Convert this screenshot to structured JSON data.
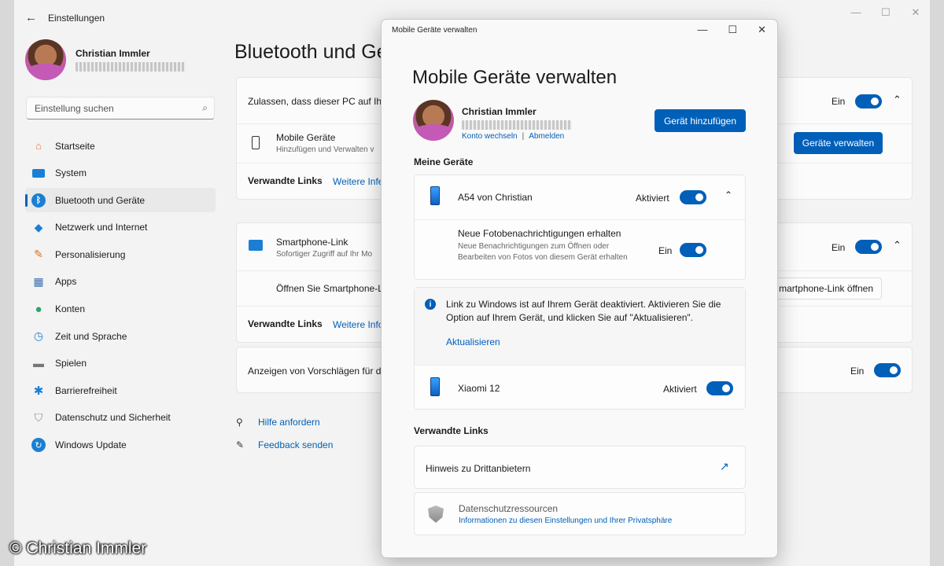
{
  "settings": {
    "title": "Einstellungen",
    "user": {
      "name": "Christian Immler"
    },
    "search": {
      "placeholder": "Einstellung suchen"
    },
    "nav": [
      {
        "label": "Startseite",
        "icon": "home-icon"
      },
      {
        "label": "System",
        "icon": "system-icon"
      },
      {
        "label": "Bluetooth und Geräte",
        "icon": "bluetooth-icon"
      },
      {
        "label": "Netzwerk und Internet",
        "icon": "network-icon"
      },
      {
        "label": "Personalisierung",
        "icon": "brush-icon"
      },
      {
        "label": "Apps",
        "icon": "apps-icon"
      },
      {
        "label": "Konten",
        "icon": "accounts-icon"
      },
      {
        "label": "Zeit und Sprache",
        "icon": "time-language-icon"
      },
      {
        "label": "Spielen",
        "icon": "gaming-icon"
      },
      {
        "label": "Barrierefreiheit",
        "icon": "accessibility-icon"
      },
      {
        "label": "Datenschutz und Sicherheit",
        "icon": "privacy-shield-icon"
      },
      {
        "label": "Windows Update",
        "icon": "update-icon"
      }
    ],
    "page_title": "Bluetooth und Ge",
    "card1": {
      "allow_label": "Zulassen, dass dieser PC auf Ihr",
      "allow_state": "Ein",
      "mobile_title": "Mobile Geräte",
      "mobile_sub": "Hinzufügen und Verwalten v",
      "manage_button": "Geräte verwalten",
      "related_label": "Verwandte Links",
      "related_link": "Weitere Infe"
    },
    "card2": {
      "title": "Smartphone-Link",
      "sub": "Sofortiger Zugriff auf Ihr Mo",
      "state": "Ein",
      "open_label": "Öffnen Sie Smartphone-L",
      "open_button": "martphone-Link öffnen",
      "related_label": "Verwandte Links",
      "related_link": "Weitere Info"
    },
    "card3": {
      "label": "Anzeigen von Vorschlägen für d",
      "state": "Ein"
    },
    "help": "Hilfe anfordern",
    "feedback": "Feedback senden",
    "accent": "#005fb8"
  },
  "dialog": {
    "window_title": "Mobile Geräte verwalten",
    "heading": "Mobile Geräte verwalten",
    "user_name": "Christian Immler",
    "switch_account": "Konto wechseln",
    "separator": "|",
    "sign_out": "Abmelden",
    "add_device": "Gerät hinzufügen",
    "my_devices_label": "Meine Geräte",
    "device1": {
      "name": "A54 von Christian",
      "state": "Aktiviert",
      "option_title": "Neue Fotobenachrichtigungen erhalten",
      "option_desc": "Neue Benachrichtigungen zum Öffnen oder Bearbeiten von Fotos von diesem Gerät erhalten",
      "option_state": "Ein"
    },
    "info": {
      "text": "Link zu Windows ist auf Ihrem Gerät deaktiviert. Aktivieren Sie die Option auf Ihrem Gerät, und klicken Sie auf \"Aktualisieren\".",
      "action": "Aktualisieren"
    },
    "device2": {
      "name": "Xiaomi 12",
      "state": "Aktiviert"
    },
    "related_label": "Verwandte Links",
    "third_party": "Hinweis zu Drittanbietern",
    "privacy_title": "Datenschutzressourcen",
    "privacy_link": "Informationen zu diesen Einstellungen und Ihrer Privatsphäre"
  },
  "watermark": "© Christian Immler"
}
